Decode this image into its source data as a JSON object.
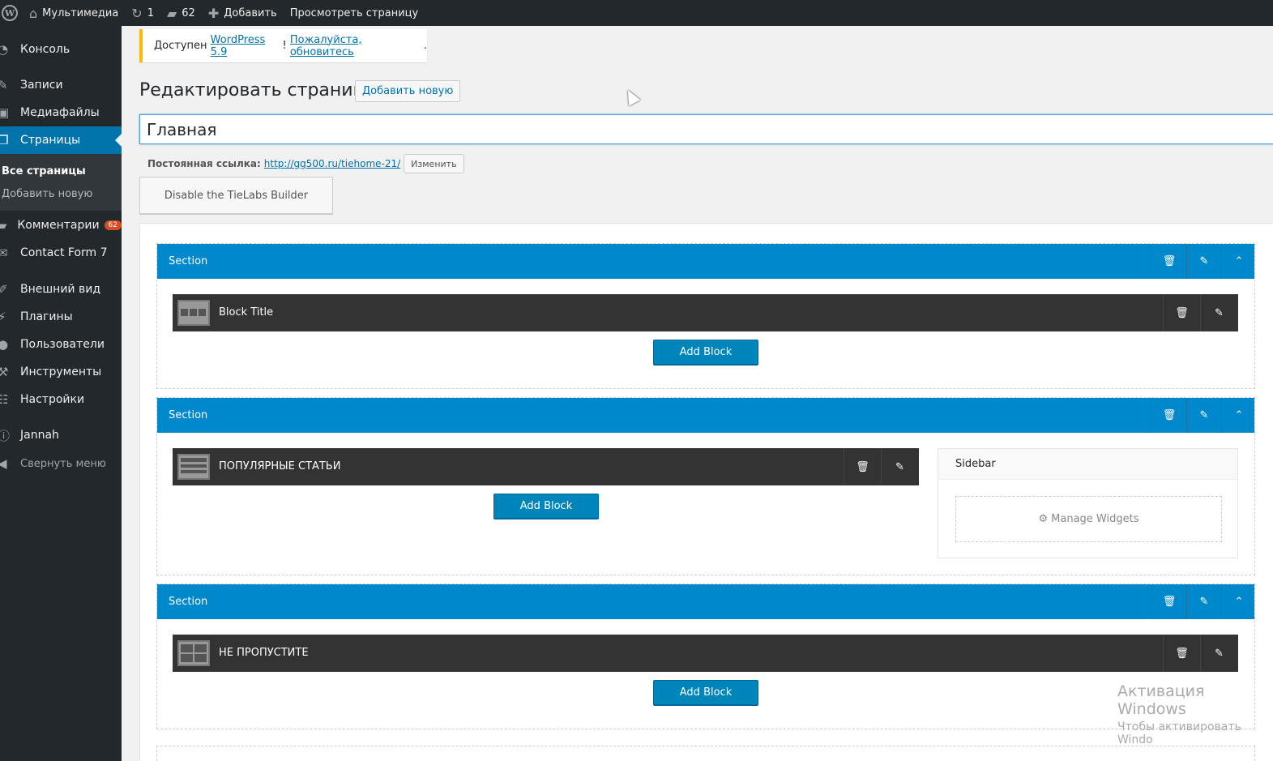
{
  "adminbar": {
    "site_name": "Мультимедиа",
    "updates_count": "1",
    "comments_count": "62",
    "add_new": "Добавить",
    "view_page": "Просмотреть страницу",
    "wp_logo": "W"
  },
  "menu": {
    "items": [
      {
        "label": "Консоль",
        "icon": "dashboard-icon"
      },
      {
        "label": "Записи",
        "icon": "pin-icon"
      },
      {
        "label": "Медиафайлы",
        "icon": "media-icon"
      },
      {
        "label": "Страницы",
        "icon": "pages-icon"
      },
      {
        "label": "Комментарии",
        "icon": "comments-icon",
        "badge": "62"
      },
      {
        "label": "Contact Form 7",
        "icon": "mail-icon"
      },
      {
        "label": "Внешний вид",
        "icon": "brush-icon"
      },
      {
        "label": "Плагины",
        "icon": "plugin-icon"
      },
      {
        "label": "Пользователи",
        "icon": "users-icon"
      },
      {
        "label": "Инструменты",
        "icon": "tools-icon"
      },
      {
        "label": "Настройки",
        "icon": "settings-icon"
      },
      {
        "label": "Jannah",
        "icon": "info-icon"
      },
      {
        "label": "Свернуть меню",
        "icon": "collapse-icon"
      }
    ],
    "submenu": {
      "all_pages": "Все страницы",
      "add_new": "Добавить новую"
    }
  },
  "notice": {
    "prefix": "Доступен ",
    "version_link": "WordPress 5.9",
    "mid": "! ",
    "update_link": "Пожалуйста, обновитесь",
    "suffix": "."
  },
  "header": {
    "title": "Редактировать страницу",
    "add_new": "Добавить новую"
  },
  "post_title": "Главная",
  "permalink": {
    "label": "Постоянная ссылка:",
    "url": "http://gg500.ru/tiehome-21/",
    "edit": "Изменить"
  },
  "builder_toggle": "Disable the TieLabs Builder",
  "sections": [
    {
      "label": "Section",
      "block_title": "Block Title",
      "add_block": "Add Block"
    },
    {
      "label": "Section",
      "block_title": "ПОПУЛЯРНЫЕ СТАТЬИ",
      "add_block": "Add Block",
      "sidebar": "Sidebar",
      "manage_widgets": "Manage Widgets"
    },
    {
      "label": "Section",
      "block_title": "НЕ ПРОПУСТИТЕ",
      "add_block": "Add Block"
    }
  ],
  "watermark": {
    "line1": "Активация Windows",
    "line2": "Чтобы активировать Windo"
  },
  "colors": {
    "accent": "#0073aa",
    "section_header": "#0088cc",
    "block_bg": "#333333",
    "sidebar_bg": "#23282d",
    "notice_border": "#ffb900"
  }
}
